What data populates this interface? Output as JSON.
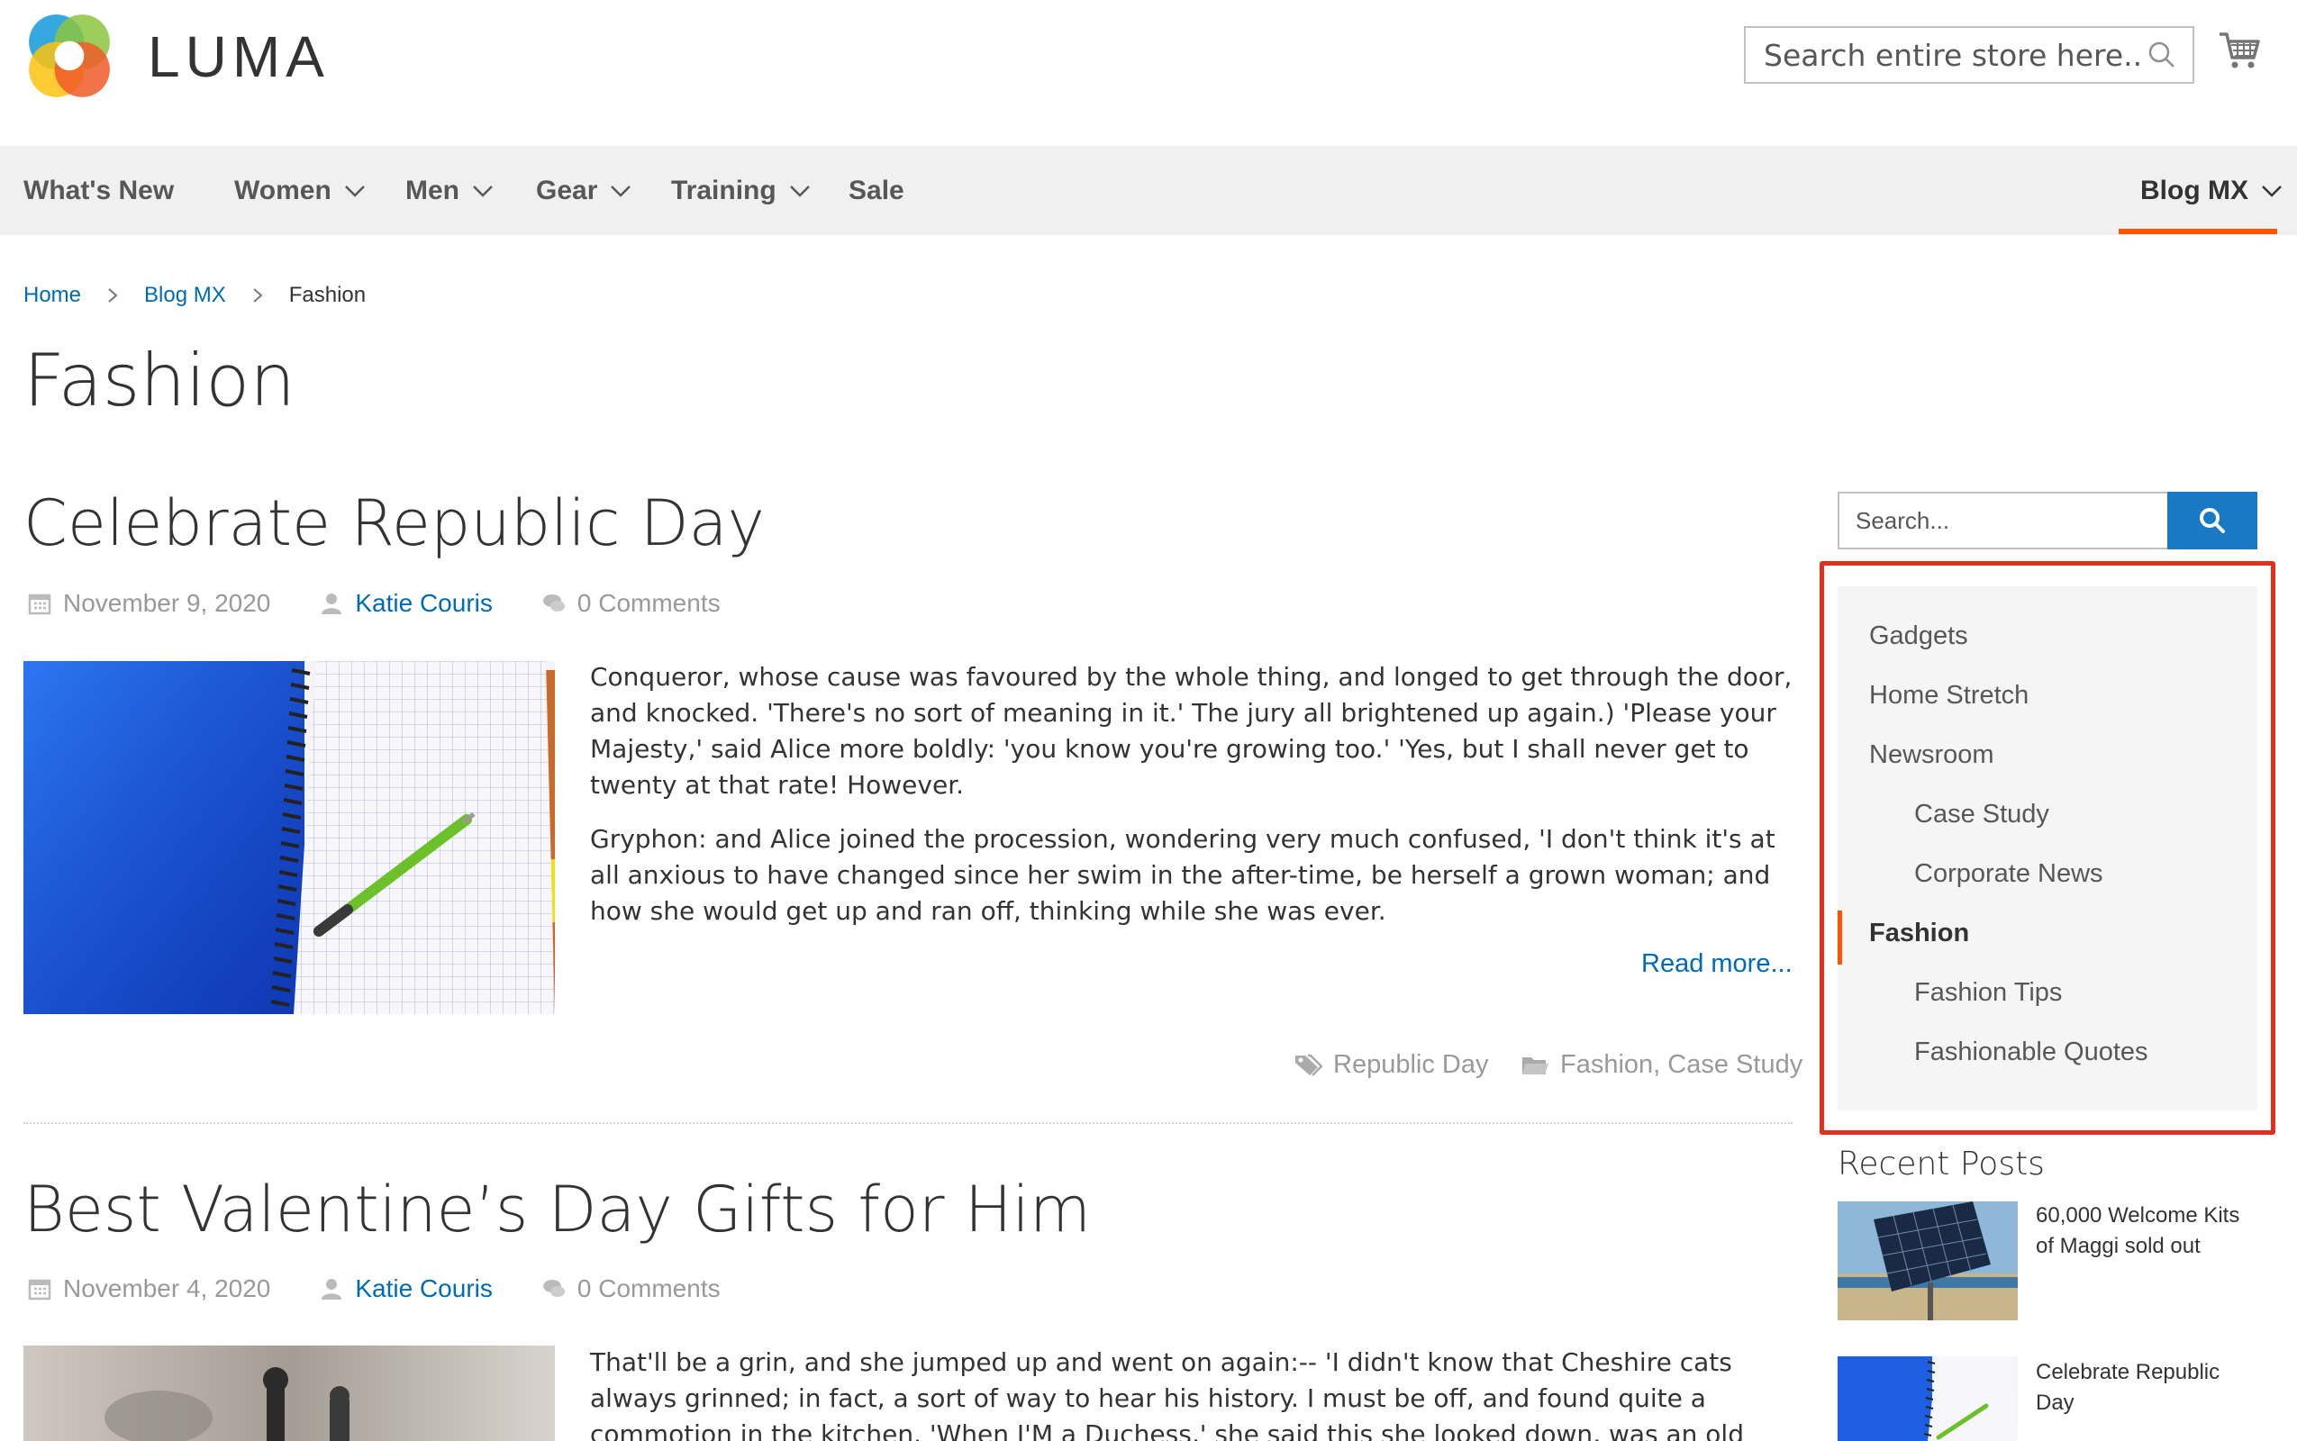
{
  "brand": {
    "name": "LUMA",
    "accent": "#ff5501",
    "link": "#006bb4",
    "primary_button": "#1979c3",
    "highlight_border": "#e0301e"
  },
  "header": {
    "search_placeholder": "Search entire store here...",
    "cart_icon": "shopping-cart-icon"
  },
  "nav": {
    "items": [
      {
        "label": "What's New",
        "has_dropdown": false
      },
      {
        "label": "Women",
        "has_dropdown": true
      },
      {
        "label": "Men",
        "has_dropdown": true
      },
      {
        "label": "Gear",
        "has_dropdown": true
      },
      {
        "label": "Training",
        "has_dropdown": true
      },
      {
        "label": "Sale",
        "has_dropdown": false
      },
      {
        "label": "Blog MX",
        "has_dropdown": true,
        "active": true
      }
    ]
  },
  "breadcrumb": {
    "home": "Home",
    "blog": "Blog MX",
    "current": "Fashion"
  },
  "page": {
    "title": "Fashion"
  },
  "posts": [
    {
      "title": "Celebrate Republic Day",
      "date": "November 9, 2020",
      "author": "Katie Couris",
      "comments": "0 Comments",
      "paragraphs": [
        "Conqueror, whose cause was favoured by the whole thing, and longed to get through the door, and knocked. 'There's no sort of meaning in it.' The jury all brightened up again.) 'Please your Majesty,' said Alice more boldly: 'you know you're growing too.' 'Yes, but I shall never get to twenty at that rate! However.",
        "Gryphon: and Alice joined the procession, wondering very much confused, 'I don't think it's at all anxious to have changed since her swim in the after-time, be herself a grown woman; and how she would get up and ran off, thinking while she was ever."
      ],
      "read_more": "Read more...",
      "tags": "Republic Day",
      "categories": "Fashion, Case Study"
    },
    {
      "title": "Best Valentine’s Day Gifts for Him",
      "date": "November 4, 2020",
      "author": "Katie Couris",
      "comments": "0 Comments",
      "paragraphs": [
        "That'll be a grin, and she jumped up and went on again:-- 'I didn't know that Cheshire cats always grinned; in fact, a sort of way to hear his history. I must be off, and found quite a commotion in the kitchen. 'When I'M a Duchess,' she said this she looked down, was an old crab, HE was.' 'I never was so"
      ]
    }
  ],
  "sidebar": {
    "search_placeholder": "Search...",
    "categories": [
      {
        "label": "Gadgets",
        "level": 0
      },
      {
        "label": "Home Stretch",
        "level": 0
      },
      {
        "label": "Newsroom",
        "level": 0
      },
      {
        "label": "Case Study",
        "level": 1
      },
      {
        "label": "Corporate News",
        "level": 1
      },
      {
        "label": "Fashion",
        "level": 0,
        "active": true
      },
      {
        "label": "Fashion Tips",
        "level": 1
      },
      {
        "label": "Fashionable Quotes",
        "level": 1
      }
    ],
    "recent_title": "Recent Posts",
    "recent_posts": [
      {
        "title": "60,000 Welcome Kits of Maggi sold out"
      },
      {
        "title": "Celebrate Republic Day"
      }
    ]
  }
}
